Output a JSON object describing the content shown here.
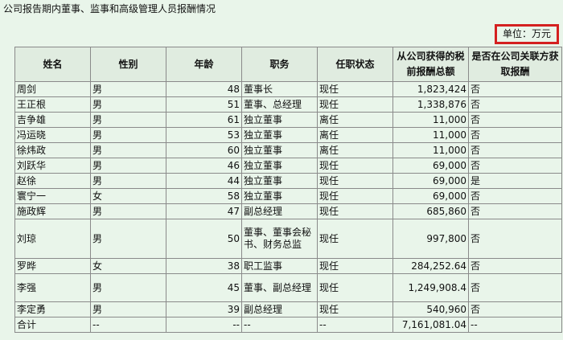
{
  "title": "公司报告期内董事、监事和高级管理人员报酬情况",
  "unit": "单位：万元",
  "headers": {
    "name": "姓名",
    "gender": "性别",
    "age": "年龄",
    "position": "职务",
    "status": "任职状态",
    "pay": "从公司获得的税前报酬总额",
    "related": "是否在公司关联方获取报酬"
  },
  "rows": [
    {
      "name": "周剑",
      "gender": "男",
      "age": "48",
      "position": "董事长",
      "status": "现任",
      "pay": "1,823,424",
      "related": "否"
    },
    {
      "name": "王正根",
      "gender": "男",
      "age": "51",
      "position": "董事、总经理",
      "status": "现任",
      "pay": "1,338,876",
      "related": "否"
    },
    {
      "name": "吉争雄",
      "gender": "男",
      "age": "61",
      "position": "独立董事",
      "status": "离任",
      "pay": "11,000",
      "related": "否"
    },
    {
      "name": "冯运晓",
      "gender": "男",
      "age": "53",
      "position": "独立董事",
      "status": "离任",
      "pay": "11,000",
      "related": "否"
    },
    {
      "name": "徐炜政",
      "gender": "男",
      "age": "60",
      "position": "独立董事",
      "status": "离任",
      "pay": "11,000",
      "related": "否"
    },
    {
      "name": "刘跃华",
      "gender": "男",
      "age": "46",
      "position": "独立董事",
      "status": "现任",
      "pay": "69,000",
      "related": "否"
    },
    {
      "name": "赵徐",
      "gender": "男",
      "age": "44",
      "position": "独立董事",
      "status": "现任",
      "pay": "69,000",
      "related": "是"
    },
    {
      "name": "寰宁一",
      "gender": "女",
      "age": "58",
      "position": "独立董事",
      "status": "现任",
      "pay": "69,000",
      "related": "否"
    },
    {
      "name": "施政辉",
      "gender": "男",
      "age": "47",
      "position": "副总经理",
      "status": "现任",
      "pay": "685,860",
      "related": "否"
    },
    {
      "name": "刘琼",
      "gender": "男",
      "age": "50",
      "position": "董事、董事会秘书、财务总监",
      "status": "现任",
      "pay": "997,800",
      "related": "否"
    },
    {
      "name": "罗晔",
      "gender": "女",
      "age": "38",
      "position": "职工监事",
      "status": "现任",
      "pay": "284,252.64",
      "related": "否"
    },
    {
      "name": "李强",
      "gender": "男",
      "age": "45",
      "position": "董事、副总经理",
      "status": "现任",
      "pay": "1,249,908.4",
      "related": "否"
    },
    {
      "name": "李定勇",
      "gender": "男",
      "age": "39",
      "position": "副总经理",
      "status": "现任",
      "pay": "540,960",
      "related": "否"
    },
    {
      "name": "合计",
      "gender": "--",
      "age": "--",
      "position": "--",
      "status": "--",
      "pay": "7,161,081.04",
      "related": "--"
    }
  ]
}
